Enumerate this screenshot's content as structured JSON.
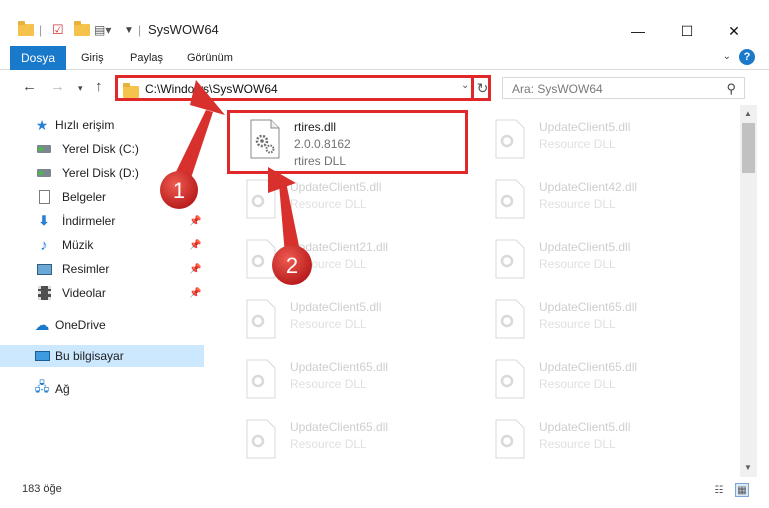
{
  "window": {
    "title": "SysWOW64",
    "minimize_glyph": "—",
    "maximize_glyph": "☐",
    "close_glyph": "✕"
  },
  "ribbon": {
    "file_tab": "Dosya",
    "tabs": [
      "Giriş",
      "Paylaş",
      "Görünüm"
    ],
    "help_glyph": "?"
  },
  "address": {
    "path": "C:\\Windows\\SysWOW64",
    "search_placeholder": "Ara: SysWOW64"
  },
  "sidebar": {
    "quick_access": "Hızlı erişim",
    "items": [
      {
        "label": "Yerel Disk (C:)",
        "icon": "drive-icon"
      },
      {
        "label": "Yerel Disk (D:)",
        "icon": "drive-icon"
      },
      {
        "label": "Belgeler",
        "icon": "documents-icon"
      },
      {
        "label": "İndirmeler",
        "icon": "downloads-icon"
      },
      {
        "label": "Müzik",
        "icon": "music-icon"
      },
      {
        "label": "Resimler",
        "icon": "pictures-icon"
      },
      {
        "label": "Videolar",
        "icon": "videos-icon"
      }
    ],
    "onedrive": "OneDrive",
    "this_pc": "Bu bilgisayar",
    "network": "Ağ"
  },
  "files": [
    {
      "name": "rtires.dll",
      "line2": "2.0.0.8162",
      "line3": "rtires DLL"
    },
    {
      "name": "UpdateClient5.dll",
      "line2": "Resource DLL",
      "line3": ""
    },
    {
      "name": "UpdateClient5.dll",
      "line2": "Resource DLL",
      "line3": ""
    },
    {
      "name": "UpdateClient42.dll",
      "line2": "Resource DLL",
      "line3": ""
    },
    {
      "name": "UpdateClient21.dll",
      "line2": "Resource DLL",
      "line3": ""
    },
    {
      "name": "UpdateClient5.dll",
      "line2": "Resource DLL",
      "line3": ""
    },
    {
      "name": "UpdateClient5.dll",
      "line2": "Resource DLL",
      "line3": ""
    },
    {
      "name": "UpdateClient65.dll",
      "line2": "Resource DLL",
      "line3": ""
    },
    {
      "name": "UpdateClient65.dll",
      "line2": "Resource DLL",
      "line3": ""
    },
    {
      "name": "UpdateClient65.dll",
      "line2": "Resource DLL",
      "line3": ""
    },
    {
      "name": "UpdateClient65.dll",
      "line2": "Resource DLL",
      "line3": ""
    },
    {
      "name": "UpdateClient5.dll",
      "line2": "Resource DLL",
      "line3": ""
    }
  ],
  "status": {
    "item_count": "183 öğe"
  },
  "annotations": {
    "step1": "1",
    "step2": "2",
    "highlight_color": "#e0272a"
  }
}
